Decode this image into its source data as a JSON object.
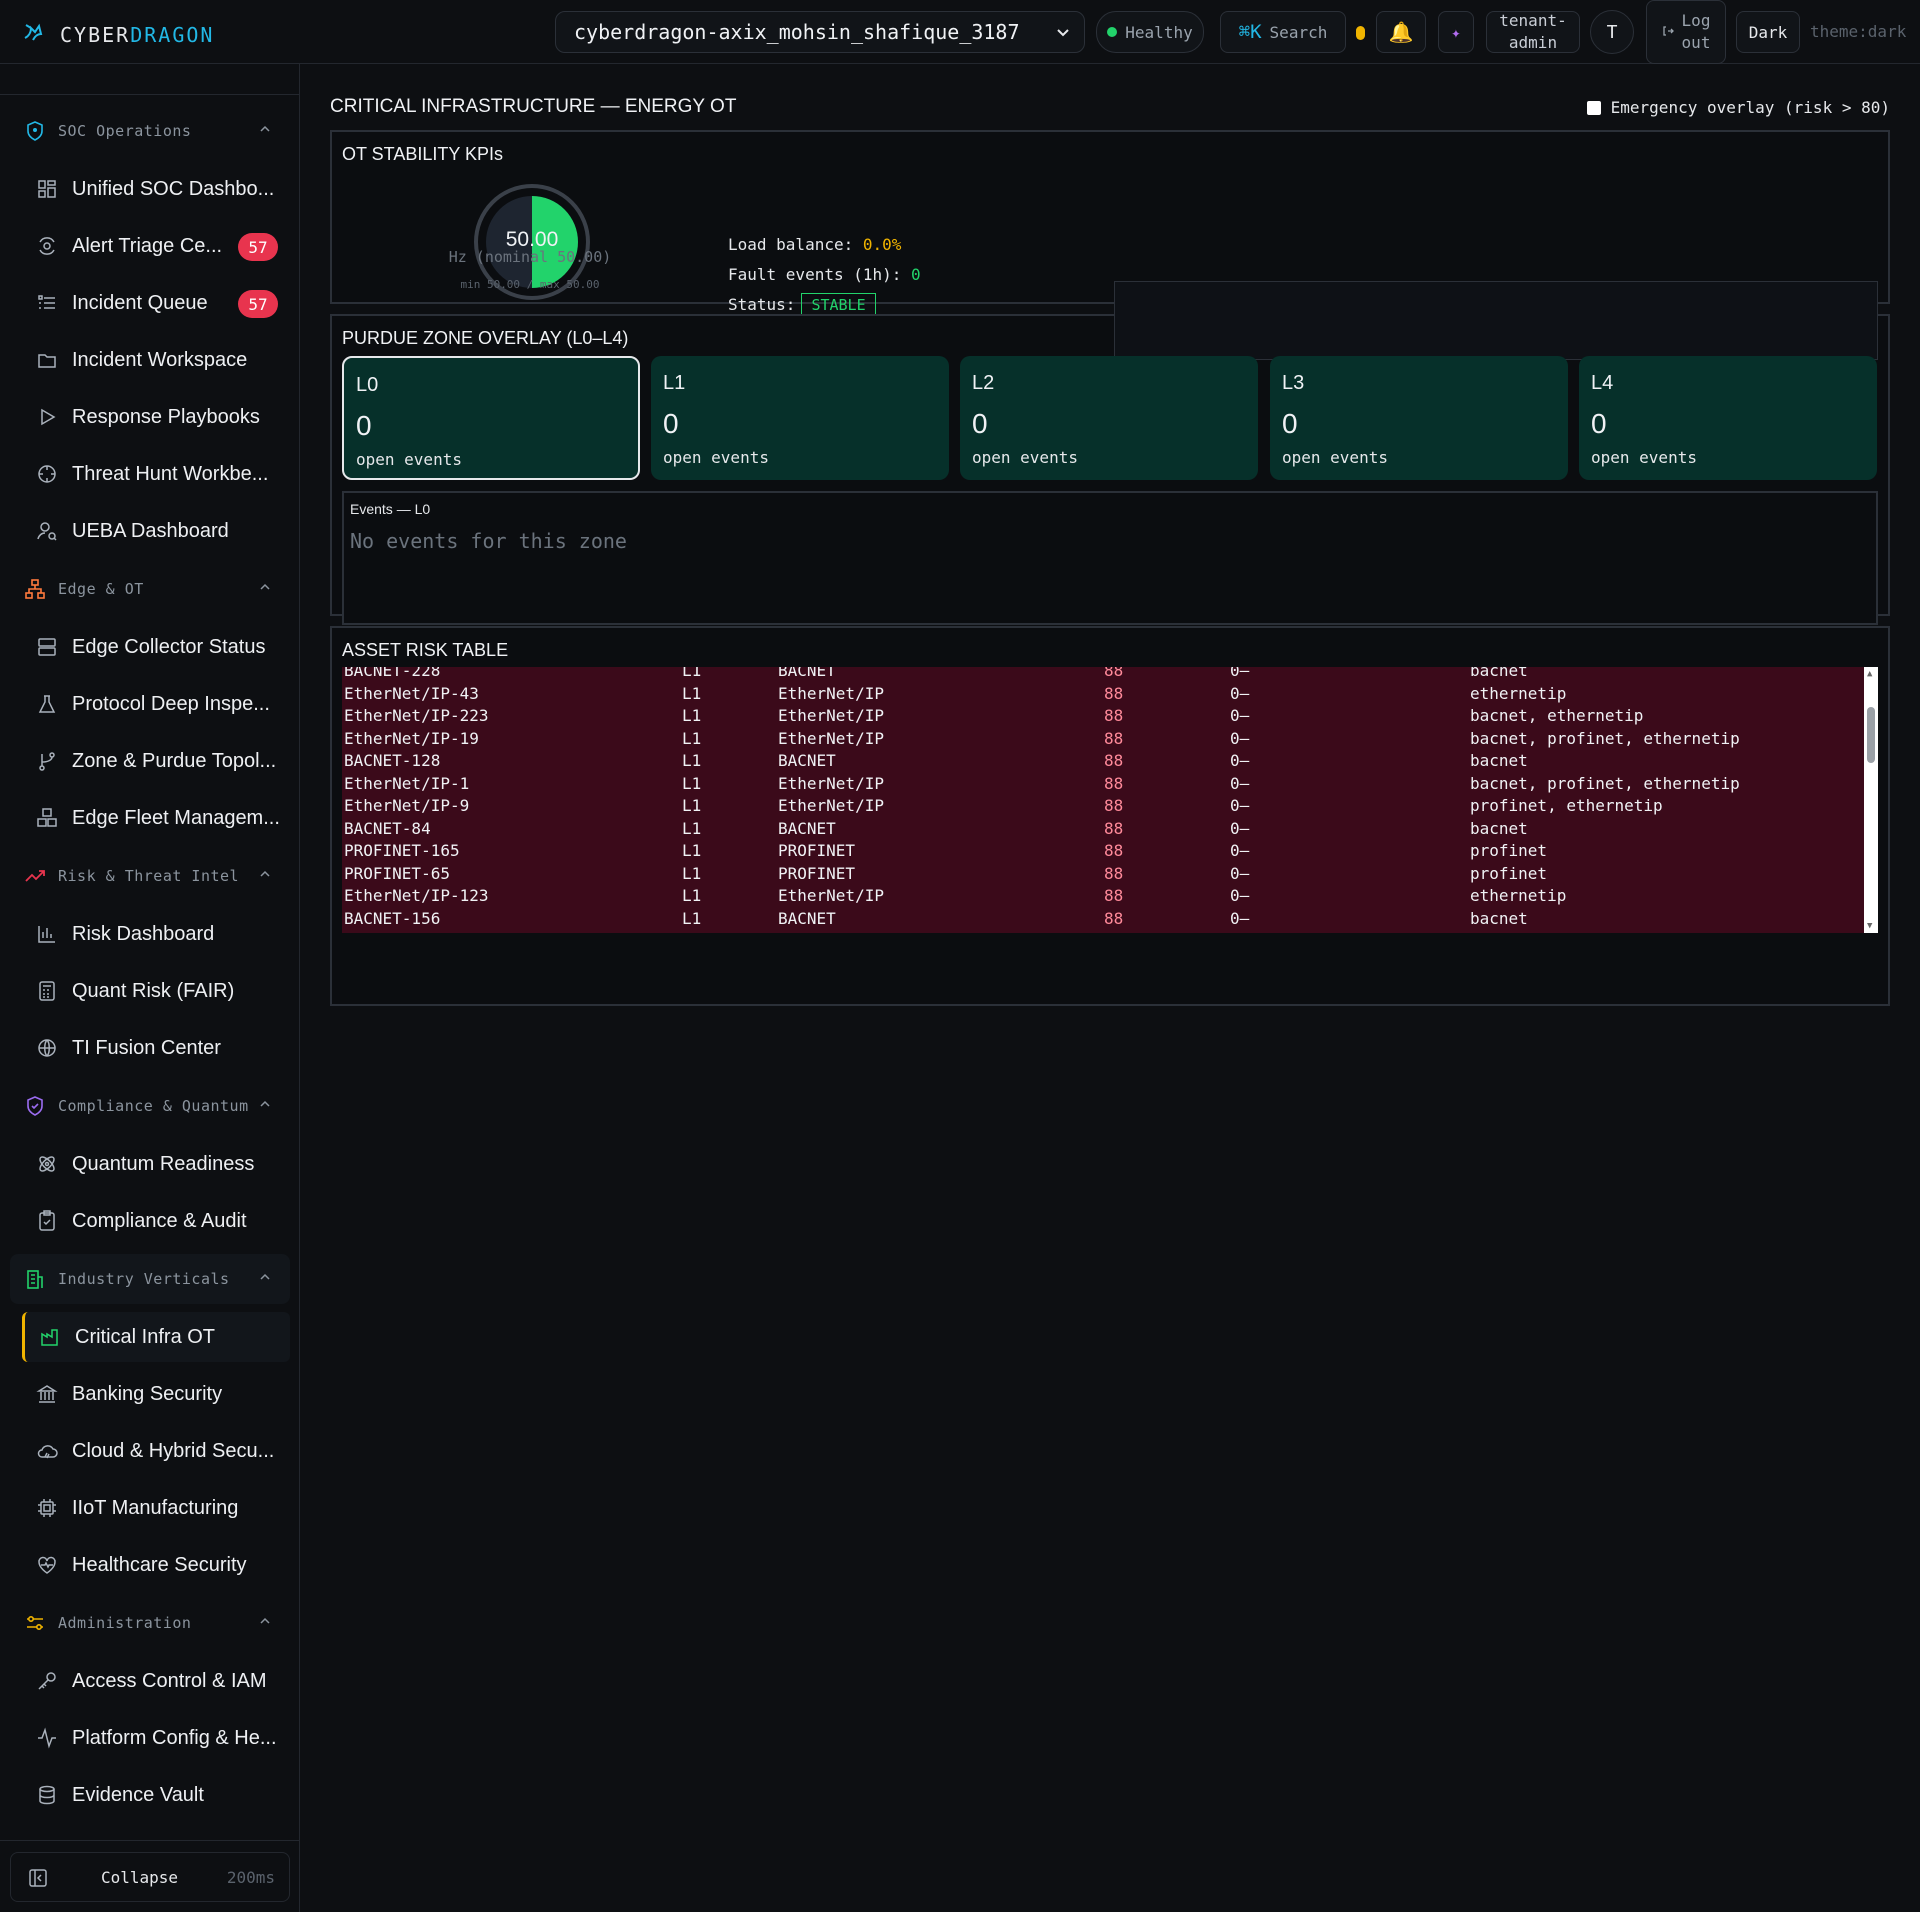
{
  "brand": {
    "part1": "CYBER",
    "part2": "DRAGON"
  },
  "topbar": {
    "tenant": "cyberdragon-axix_mohsin_shafique_3187",
    "health": "Healthy",
    "search_key": "⌘K",
    "search": "Search",
    "tenant_admin_1": "tenant-",
    "tenant_admin_2": "admin",
    "avatar": "T",
    "logout_1": "Log",
    "logout_2": "out",
    "theme_button": "Dark",
    "theme_label": "theme:dark"
  },
  "sidebar": {
    "sections": {
      "soc": "SOC Operations",
      "edge": "Edge & OT",
      "risk": "Risk & Threat Intel",
      "compliance": "Compliance & Quantum",
      "industry": "Industry Verticals",
      "admin": "Administration"
    },
    "items": {
      "unified_soc": "Unified SOC Dashbo...",
      "alert_triage": "Alert Triage Ce...",
      "alert_triage_badge": "57",
      "incident_queue": "Incident Queue",
      "incident_queue_badge": "57",
      "incident_workspace": "Incident Workspace",
      "response_playbooks": "Response Playbooks",
      "threat_hunt": "Threat Hunt Workbe...",
      "ueba": "UEBA Dashboard",
      "edge_collector": "Edge Collector Status",
      "protocol_deep": "Protocol Deep Inspe...",
      "zone_purdue": "Zone & Purdue Topol...",
      "edge_fleet": "Edge Fleet Managem...",
      "risk_dashboard": "Risk Dashboard",
      "quant_risk": "Quant Risk (FAIR)",
      "ti_fusion": "TI Fusion Center",
      "quantum_readiness": "Quantum Readiness",
      "compliance_audit": "Compliance & Audit",
      "critical_infra": "Critical Infra OT",
      "banking": "Banking Security",
      "cloud_hybrid": "Cloud & Hybrid Secu...",
      "iiot": "IIoT Manufacturing",
      "healthcare": "Healthcare Security",
      "access_control": "Access Control & IAM",
      "platform_config": "Platform Config & He...",
      "evidence_vault": "Evidence Vault"
    },
    "collapse": "Collapse",
    "collapse_ms": "200ms"
  },
  "main": {
    "title": "CRITICAL INFRASTRUCTURE — ENERGY OT",
    "emergency_overlay": "Emergency overlay (risk > 80)",
    "kpi": {
      "title": "OT STABILITY KPIs",
      "gauge_value": "50.00",
      "gauge_fill_fraction": 0.5,
      "hz_label": "Hz (nominal 50.00)",
      "minmax": "min 50.00 / max 50.00",
      "load_label": "Load balance:",
      "load_value": "0.0%",
      "fault_label": "Fault events (1h):",
      "fault_value": "0",
      "status_label": "Status:",
      "status_value": "STABLE"
    },
    "purdue": {
      "title": "PURDUE ZONE OVERLAY (L0–L4)",
      "zones": [
        {
          "label": "L0",
          "count": "0",
          "caption": "open events"
        },
        {
          "label": "L1",
          "count": "0",
          "caption": "open events"
        },
        {
          "label": "L2",
          "count": "0",
          "caption": "open events"
        },
        {
          "label": "L3",
          "count": "0",
          "caption": "open events"
        },
        {
          "label": "L4",
          "count": "0",
          "caption": "open events"
        }
      ],
      "events_title": "Events — L0",
      "events_empty": "No events for this zone"
    },
    "asset": {
      "title": "ASSET RISK TABLE",
      "rows": [
        {
          "asset": "BACNET-228",
          "zone": "L1",
          "protocol": "BACNET",
          "risk": "88",
          "events": "0–",
          "tags": "bacnet"
        },
        {
          "asset": "EtherNet/IP-43",
          "zone": "L1",
          "protocol": "EtherNet/IP",
          "risk": "88",
          "events": "0–",
          "tags": "ethernetip"
        },
        {
          "asset": "EtherNet/IP-223",
          "zone": "L1",
          "protocol": "EtherNet/IP",
          "risk": "88",
          "events": "0–",
          "tags": "bacnet, ethernetip"
        },
        {
          "asset": "EtherNet/IP-19",
          "zone": "L1",
          "protocol": "EtherNet/IP",
          "risk": "88",
          "events": "0–",
          "tags": "bacnet, profinet, ethernetip"
        },
        {
          "asset": "BACNET-128",
          "zone": "L1",
          "protocol": "BACNET",
          "risk": "88",
          "events": "0–",
          "tags": "bacnet"
        },
        {
          "asset": "EtherNet/IP-1",
          "zone": "L1",
          "protocol": "EtherNet/IP",
          "risk": "88",
          "events": "0–",
          "tags": "bacnet, profinet, ethernetip"
        },
        {
          "asset": "EtherNet/IP-9",
          "zone": "L1",
          "protocol": "EtherNet/IP",
          "risk": "88",
          "events": "0–",
          "tags": "profinet, ethernetip"
        },
        {
          "asset": "BACNET-84",
          "zone": "L1",
          "protocol": "BACNET",
          "risk": "88",
          "events": "0–",
          "tags": "bacnet"
        },
        {
          "asset": "PROFINET-165",
          "zone": "L1",
          "protocol": "PROFINET",
          "risk": "88",
          "events": "0–",
          "tags": "profinet"
        },
        {
          "asset": "PROFINET-65",
          "zone": "L1",
          "protocol": "PROFINET",
          "risk": "88",
          "events": "0–",
          "tags": "profinet"
        },
        {
          "asset": "EtherNet/IP-123",
          "zone": "L1",
          "protocol": "EtherNet/IP",
          "risk": "88",
          "events": "0–",
          "tags": "ethernetip"
        },
        {
          "asset": "BACNET-156",
          "zone": "L1",
          "protocol": "BACNET",
          "risk": "88",
          "events": "0–",
          "tags": "bacnet"
        }
      ]
    }
  },
  "colors": {
    "accent": "#22b8e6",
    "healthy": "#22d36b",
    "warning": "#f0b400",
    "badge": "#e8344e",
    "zone_bg": "#06302a",
    "risk_row": "#3b0a1a"
  }
}
